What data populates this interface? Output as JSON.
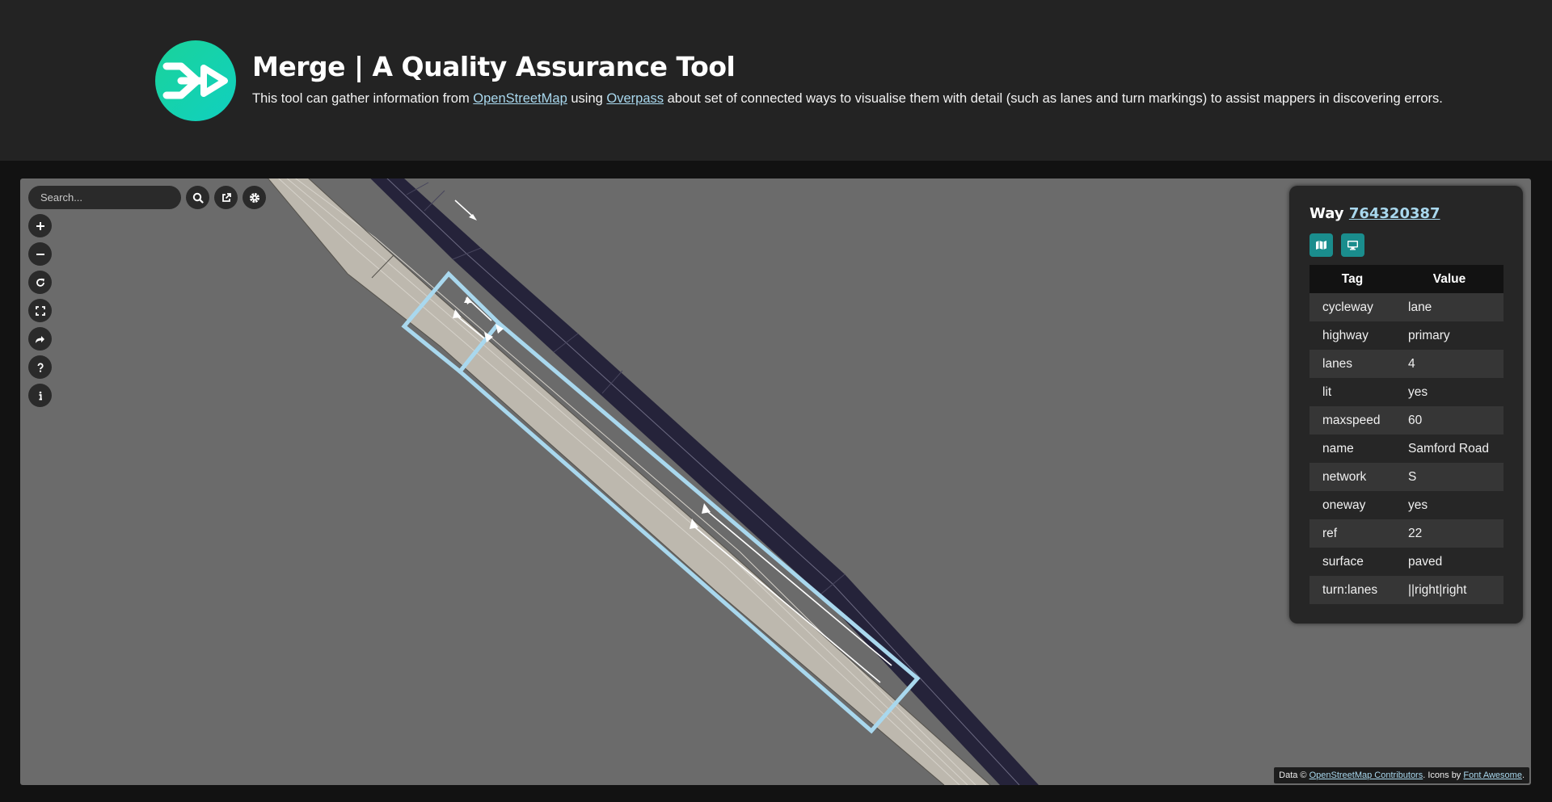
{
  "header": {
    "title": "Merge | A Quality Assurance Tool",
    "subtitle_prefix": "This tool can gather information from ",
    "subtitle_link1": "OpenStreetMap",
    "subtitle_mid": " using ",
    "subtitle_link2": "Overpass",
    "subtitle_suffix": " about set of connected ways to visualise them with detail (such as lanes and turn markings) to assist mappers in discovering errors."
  },
  "map": {
    "search_placeholder": "Search...",
    "toolbar_icons": [
      "search-icon",
      "external-link-icon",
      "gear-icon"
    ],
    "side_controls": [
      "zoom-in-icon",
      "zoom-out-icon",
      "refresh-icon",
      "fullscreen-icon",
      "share-icon",
      "help-icon",
      "info-icon"
    ],
    "colors": {
      "background": "#6b6b6b",
      "road_primary": "#bdb8ae",
      "road_dark": "#25233a",
      "selection": "#a9d8ee",
      "accent": "#1a8d8d"
    }
  },
  "panel": {
    "way_label": "Way",
    "way_id": "764320387",
    "buttons": [
      "map-icon",
      "desktop-icon"
    ],
    "columns": {
      "tag": "Tag",
      "value": "Value"
    },
    "rows": [
      {
        "key": "cycleway",
        "value": "lane"
      },
      {
        "key": "highway",
        "value": "primary"
      },
      {
        "key": "lanes",
        "value": "4"
      },
      {
        "key": "lit",
        "value": "yes"
      },
      {
        "key": "maxspeed",
        "value": "60"
      },
      {
        "key": "name",
        "value": "Samford Road"
      },
      {
        "key": "network",
        "value": "S"
      },
      {
        "key": "oneway",
        "value": "yes"
      },
      {
        "key": "ref",
        "value": "22"
      },
      {
        "key": "surface",
        "value": "paved"
      },
      {
        "key": "turn:lanes",
        "value": "||right|right"
      }
    ]
  },
  "attribution": {
    "prefix": "Data © ",
    "link1": "OpenStreetMap Contributors",
    "mid": ". Icons by ",
    "link2": "Font Awesome",
    "suffix": "."
  }
}
